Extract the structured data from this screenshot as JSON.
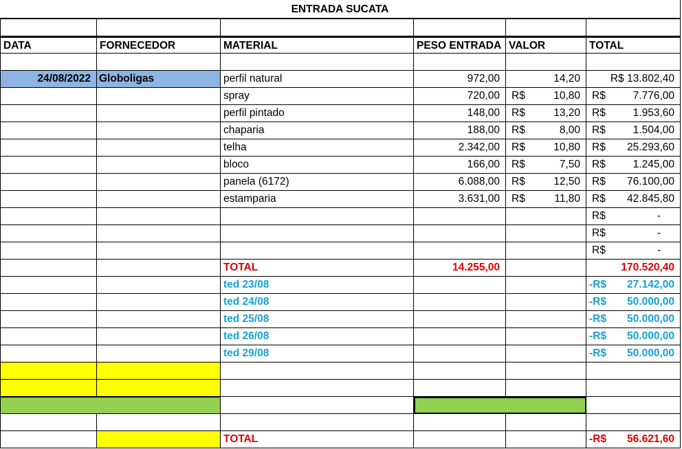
{
  "title": "ENTRADA SUCATA",
  "headers": {
    "data": "DATA",
    "fornecedor": "FORNECEDOR",
    "material": "MATERIAL",
    "peso": "PESO ENTRADA",
    "valor": "VALOR",
    "total": "TOTAL"
  },
  "entry": {
    "date": "24/08/2022",
    "supplier": "Globoligas"
  },
  "currency": "R$",
  "items": [
    {
      "material": "perfil natural",
      "peso": "972,00",
      "valor": "14,20",
      "total": "R$ 13.802,40",
      "valor_currency": false
    },
    {
      "material": "spray",
      "peso": "720,00",
      "valor": "10,80",
      "total": "7.776,00",
      "valor_currency": true
    },
    {
      "material": "perfil pintado",
      "peso": "148,00",
      "valor": "13,20",
      "total": "1.953,60",
      "valor_currency": true
    },
    {
      "material": "chaparia",
      "peso": "188,00",
      "valor": "8,00",
      "total": "1.504,00",
      "valor_currency": true
    },
    {
      "material": "telha",
      "peso": "2.342,00",
      "valor": "10,80",
      "total": "25.293,60",
      "valor_currency": true
    },
    {
      "material": "bloco",
      "peso": "166,00",
      "valor": "7,50",
      "total": "1.245,00",
      "valor_currency": true
    },
    {
      "material": "panela (6172)",
      "peso": "6.088,00",
      "valor": "12,50",
      "total": "76.100,00",
      "valor_currency": true
    },
    {
      "material": "estamparia",
      "peso": "3.631,00",
      "valor": "11,80",
      "total": "42.845,80",
      "valor_currency": true
    }
  ],
  "empty_totals": [
    "-",
    "-",
    "-"
  ],
  "total_row": {
    "label": "TOTAL",
    "peso": "14.255,00",
    "total": "170.520,40"
  },
  "payments": [
    {
      "label": "ted 23/08",
      "prefix": "-R$",
      "amount": "27.142,00"
    },
    {
      "label": "ted 24/08",
      "prefix": "-R$",
      "amount": "50.000,00"
    },
    {
      "label": "ted 25/08",
      "prefix": "-R$",
      "amount": "50.000,00"
    },
    {
      "label": "ted 26/08",
      "prefix": "-R$",
      "amount": "50.000,00"
    },
    {
      "label": "ted 29/08",
      "prefix": "-R$",
      "amount": "50.000,00"
    }
  ],
  "final_total": {
    "label": "TOTAL",
    "prefix": "-R$",
    "amount": "56.621,60"
  },
  "colors": {
    "date_fill": "#8eb4e3",
    "highlight_yellow": "#ffff00",
    "highlight_green": "#92d050",
    "total_red": "#e00000",
    "payment_teal": "#17a1d2"
  }
}
